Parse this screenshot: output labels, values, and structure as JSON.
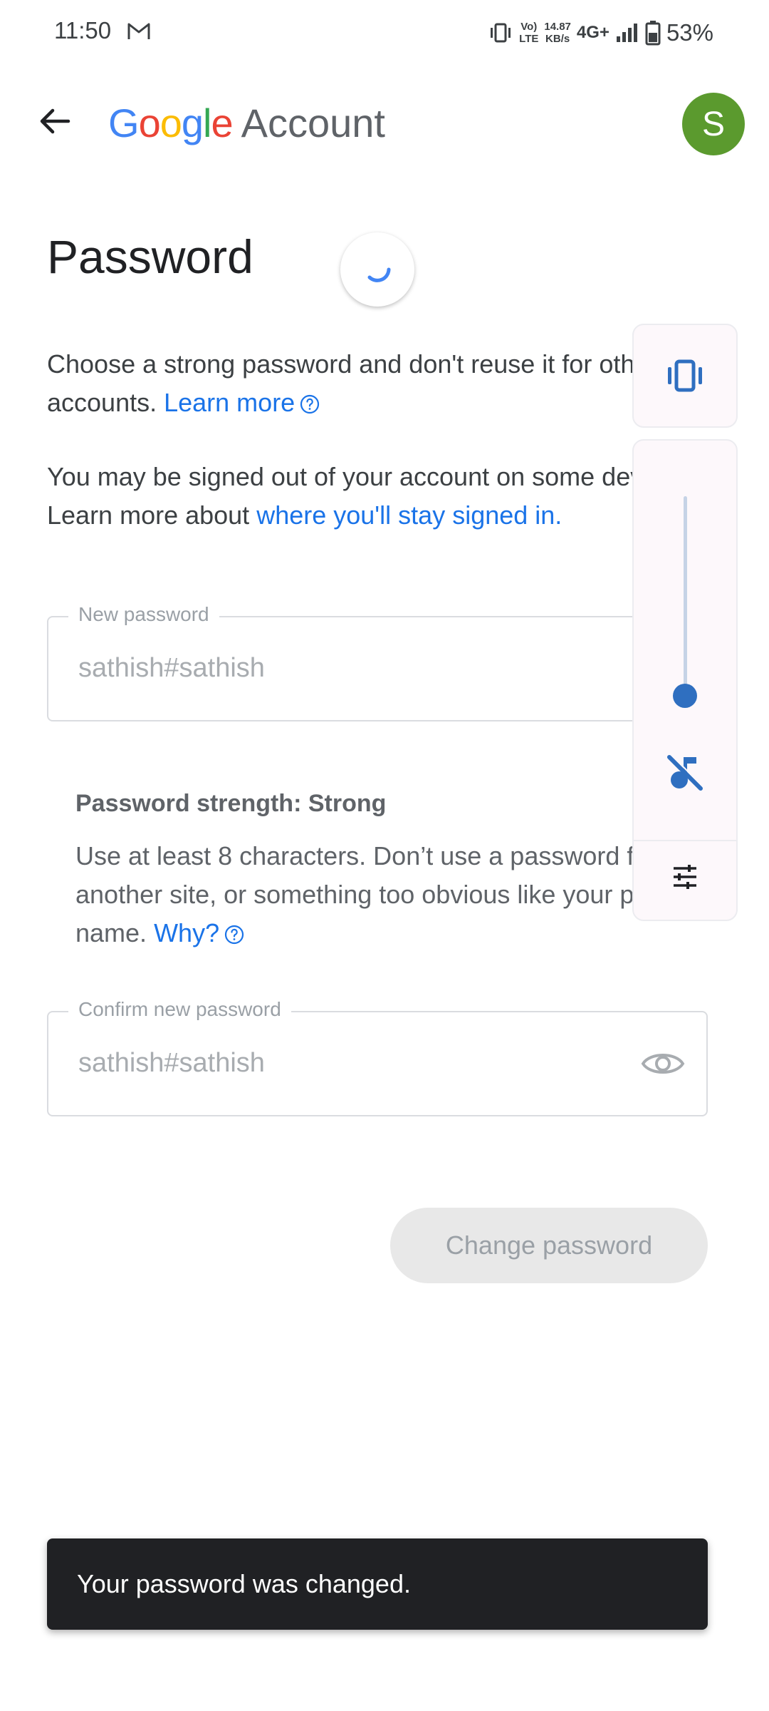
{
  "status_bar": {
    "time": "11:50",
    "volte_top": "Vo)",
    "volte_bottom": "LTE",
    "speed_value": "14.87",
    "speed_unit": "KB/s",
    "network": "4G+",
    "battery": "53%"
  },
  "app_bar": {
    "brand_letters": [
      "G",
      "o",
      "o",
      "g",
      "l",
      "e"
    ],
    "brand_word": "Account",
    "avatar_letter": "S"
  },
  "page": {
    "title": "Password",
    "intro_text": "Choose a strong password and don't reuse it for other accounts.",
    "intro_link": "Learn more",
    "signout_text": "You may be signed out of your account on some devices. Learn more about",
    "signout_link": "where you'll stay signed in."
  },
  "new_password": {
    "label": "New password",
    "value": "sathish#sathish"
  },
  "strength": {
    "title": "Password strength: Strong",
    "text": "Use at least 8 characters. Don’t use a password from another site, or something too obvious like your pet’s name.",
    "link": "Why?"
  },
  "confirm_password": {
    "label": "Confirm new password",
    "value": "sathish#sathish"
  },
  "actions": {
    "change_password": "Change password"
  },
  "snackbar": {
    "message": "Your password was changed."
  },
  "volume_panel": {
    "level": 0.0,
    "icons": [
      "vibrate-icon",
      "music-muted-icon",
      "sliders-settings-icon"
    ]
  },
  "colors": {
    "link": "#1a73e8",
    "avatar": "#5b9a2e",
    "accent": "#2f6fc0"
  }
}
